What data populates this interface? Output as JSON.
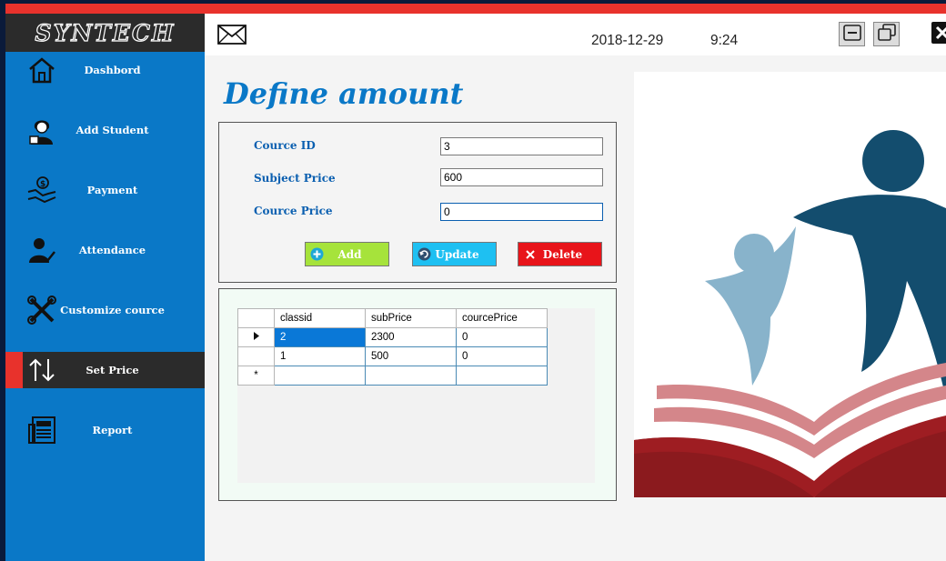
{
  "app": {
    "brand": "SYNTECH"
  },
  "header": {
    "date": "2018-12-29",
    "time": "9:24"
  },
  "sidebar": {
    "items": [
      {
        "label": "Dashbord",
        "icon": "house-icon"
      },
      {
        "label": "Add Student",
        "icon": "student-icon"
      },
      {
        "label": "Payment",
        "icon": "handshake-payment-icon"
      },
      {
        "label": "Attendance",
        "icon": "user-check-icon"
      },
      {
        "label": "Customize cource",
        "icon": "tools-icon"
      },
      {
        "label": "Set Price",
        "icon": "up-down-arrows-icon",
        "active": true
      },
      {
        "label": "Report",
        "icon": "newspaper-icon"
      }
    ]
  },
  "page": {
    "title": "Define amount"
  },
  "form": {
    "course_id": {
      "label": "Cource ID",
      "value": "3"
    },
    "subject_price": {
      "label": "Subject Price",
      "value": "600"
    },
    "course_price": {
      "label": "Cource Price",
      "value": "0"
    },
    "add_label": "Add",
    "update_label": "Update",
    "delete_label": "Delete"
  },
  "grid": {
    "columns": [
      "classid",
      "subPrice",
      "courcePrice"
    ],
    "rows": [
      [
        "2",
        "2300",
        "0"
      ],
      [
        "1",
        "500",
        "0"
      ]
    ],
    "new_row_marker": "*"
  },
  "colors": {
    "accent_blue": "#0a78c7",
    "accent_red": "#e8322c",
    "add_button": "#a6e33b",
    "update_button": "#1ec0f2",
    "delete_button": "#e8141a"
  }
}
